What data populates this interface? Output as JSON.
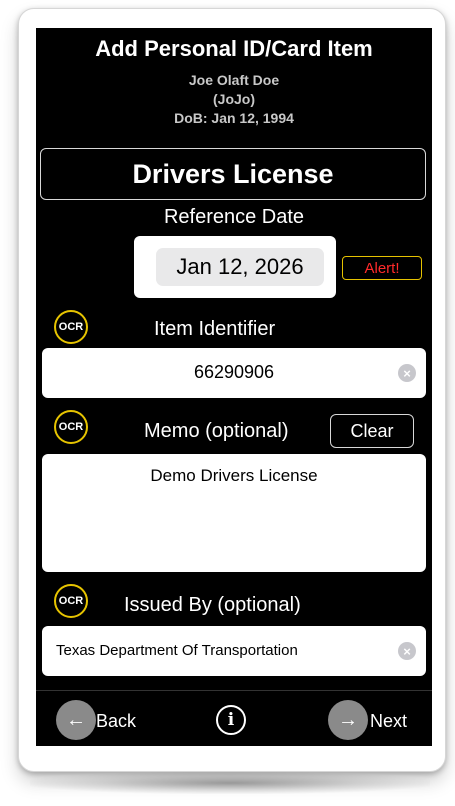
{
  "header": {
    "title": "Add Personal ID/Card Item",
    "person_name": "Joe Olaft Doe",
    "nickname": "(JoJo)",
    "dob": "DoB: Jan 12, 1994"
  },
  "document_type": "Drivers License",
  "reference_date": {
    "label": "Reference Date",
    "value": "Jan 12, 2026",
    "alert_label": "Alert!"
  },
  "ocr_label": "OCR",
  "item_identifier": {
    "label": "Item Identifier",
    "value": "66290906"
  },
  "memo": {
    "label": "Memo (optional)",
    "clear_label": "Clear",
    "value": "Demo Drivers License"
  },
  "issued_by": {
    "label": "Issued By (optional)",
    "value": "Texas Department Of Transportation"
  },
  "nav": {
    "back_label": "Back",
    "next_label": "Next",
    "back_icon": "←",
    "next_icon": "→",
    "info_icon": "i"
  },
  "icons": {
    "clear_field": "×"
  },
  "colors": {
    "background": "#000000",
    "ocr_ring": "#e7c400",
    "alert_text": "#ff2a2a",
    "nav_circle": "#8a8a8a"
  }
}
